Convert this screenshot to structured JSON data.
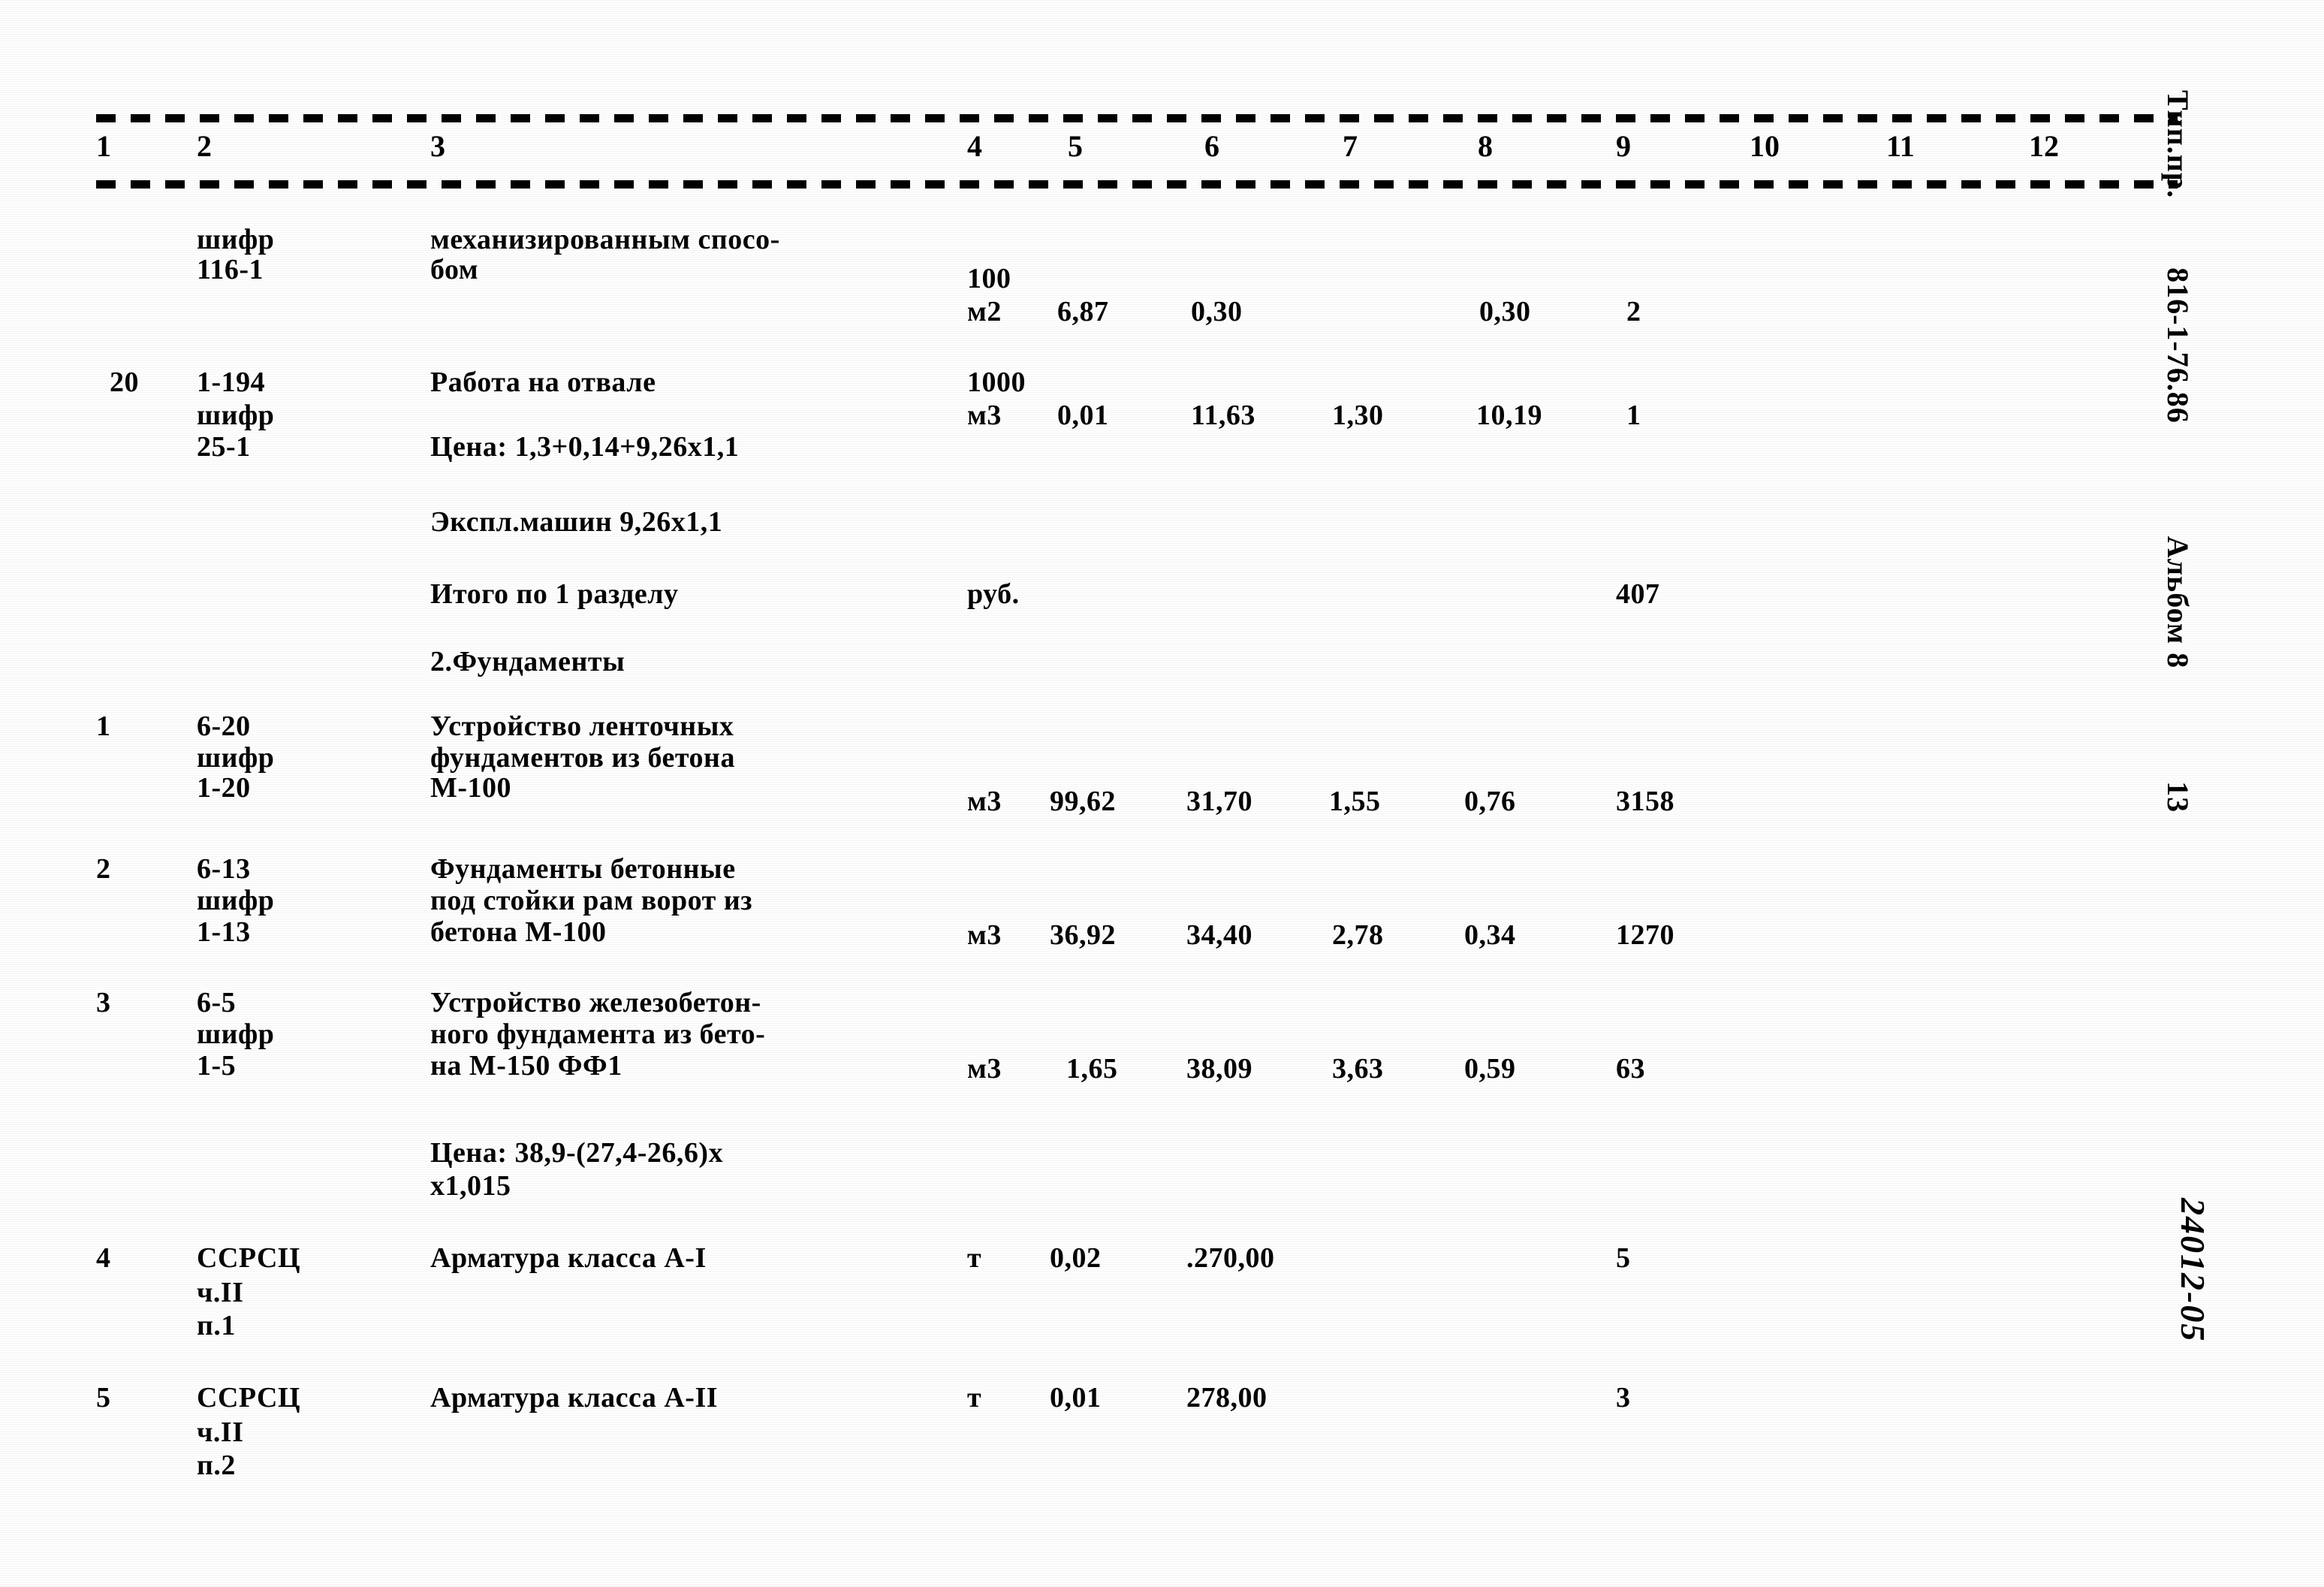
{
  "document": {
    "side_stamp": {
      "prefix": "Тип.пр.",
      "code": "816-1-76.86",
      "album": "Альбом 8",
      "page": "13"
    },
    "hand_mark": "24012-05"
  },
  "table": {
    "column_headers": [
      "1",
      "2",
      "3",
      "4",
      "5",
      "6",
      "7",
      "8",
      "9",
      "10",
      "11",
      "12"
    ],
    "rows": [
      {
        "no": "",
        "code_lines": [
          "шифр",
          "116-1"
        ],
        "name_lines": [
          "механизированным спосо-",
          "бом"
        ],
        "unit_lines": [
          "100",
          "м2"
        ],
        "c5": "6,87",
        "c6": "0,30",
        "c7": "",
        "c8": "0,30",
        "c9": "2"
      },
      {
        "no": "20",
        "code_lines": [
          "1-194",
          "шифр",
          "25-1"
        ],
        "name_lines": [
          "Работа на отвале"
        ],
        "unit_lines": [
          "1000",
          "м3"
        ],
        "c5": "0,01",
        "c6": "11,63",
        "c7": "1,30",
        "c8": "10,19",
        "c9": "1"
      },
      {
        "no": "1",
        "code_lines": [
          "6-20",
          "шифр",
          "1-20"
        ],
        "name_lines": [
          "Устройство ленточных",
          "фундаментов из бетона",
          "М-100"
        ],
        "unit_lines": [
          "м3"
        ],
        "c5": "99,62",
        "c6": "31,70",
        "c7": "1,55",
        "c8": "0,76",
        "c9": "3158"
      },
      {
        "no": "2",
        "code_lines": [
          "6-13",
          "шифр",
          "1-13"
        ],
        "name_lines": [
          "Фундаменты бетонные",
          "под стойки рам ворот из",
          "бетона М-100"
        ],
        "unit_lines": [
          "м3"
        ],
        "c5": "36,92",
        "c6": "34,40",
        "c7": "2,78",
        "c8": "0,34",
        "c9": "1270"
      },
      {
        "no": "3",
        "code_lines": [
          "6-5",
          "шифр",
          "1-5"
        ],
        "name_lines": [
          "Устройство железобетон-",
          "ного фундамента из бето-",
          "на М-150 ФФ1"
        ],
        "unit_lines": [
          "м3"
        ],
        "c5": "1,65",
        "c6": "38,09",
        "c7": "3,63",
        "c8": "0,59",
        "c9": "63"
      },
      {
        "no": "4",
        "code_lines": [
          "ССРСЦ",
          "ч.II",
          "п.1"
        ],
        "name_lines": [
          "Арматура класса А-I"
        ],
        "unit_lines": [
          "т"
        ],
        "c5": "0,02",
        "c6": ".270,00",
        "c7": "",
        "c8": "",
        "c9": "5"
      },
      {
        "no": "5",
        "code_lines": [
          "ССРСЦ",
          "ч.II",
          "п.2"
        ],
        "name_lines": [
          "Арматура класса А-II"
        ],
        "unit_lines": [
          "т"
        ],
        "c5": "0,01",
        "c6": "278,00",
        "c7": "",
        "c8": "",
        "c9": "3"
      }
    ],
    "notes": {
      "price_20": "Цена: 1,3+0,14+9,26х1,1",
      "mach_20": "Экспл.машин 9,26х1,1",
      "total_label": "Итого по 1 разделу",
      "total_unit": "руб.",
      "total_value": "407",
      "section_2_title": "2.Фундаменты",
      "price_3_line1": "Цена: 38,9-(27,4-26,6)х",
      "price_3_line2": "х1,015"
    }
  }
}
